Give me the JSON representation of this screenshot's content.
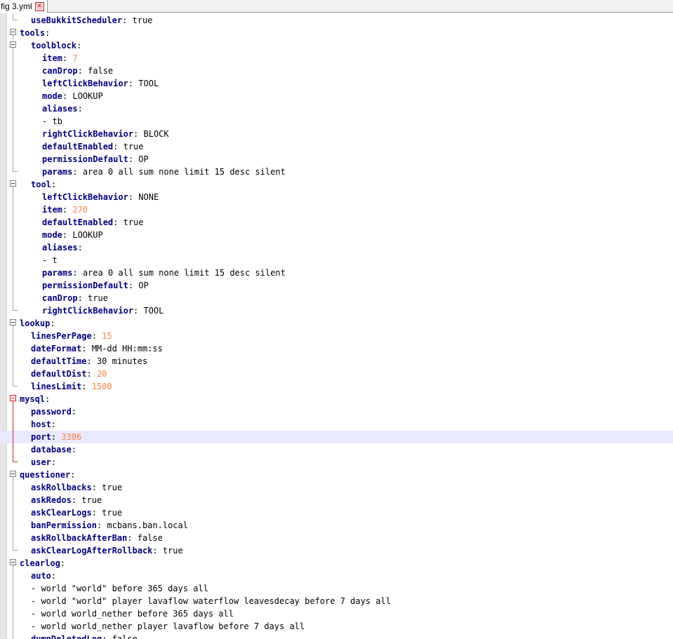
{
  "tab": {
    "label": "fig 3.yml",
    "close_glyph": "✕"
  },
  "accent_colors": {
    "key": "#000080",
    "number": "#ff8040",
    "current_line": "#e8e8ff",
    "fold_active": "#dd2222"
  },
  "lines": [
    {
      "indent": 2,
      "key": "useBukkitScheduler",
      "sep": ": ",
      "value": "true",
      "vtype": "text",
      "fold": "end"
    },
    {
      "indent": 0,
      "key": "tools",
      "sep": ":",
      "value": "",
      "vtype": "text",
      "fold": "open"
    },
    {
      "indent": 2,
      "key": "toolblock",
      "sep": ":",
      "value": "",
      "vtype": "text",
      "fold": "open"
    },
    {
      "indent": 4,
      "key": "item",
      "sep": ": ",
      "value": "7",
      "vtype": "number",
      "fold": "line"
    },
    {
      "indent": 4,
      "key": "canDrop",
      "sep": ": ",
      "value": "false",
      "vtype": "text",
      "fold": "line"
    },
    {
      "indent": 4,
      "key": "leftClickBehavior",
      "sep": ": ",
      "value": "TOOL",
      "vtype": "text",
      "fold": "line"
    },
    {
      "indent": 4,
      "key": "mode",
      "sep": ": ",
      "value": "LOOKUP",
      "vtype": "text",
      "fold": "line"
    },
    {
      "indent": 4,
      "key": "aliases",
      "sep": ":",
      "value": "",
      "vtype": "text",
      "fold": "line"
    },
    {
      "indent": 4,
      "key": "",
      "sep": "",
      "value": "- tb",
      "vtype": "text",
      "fold": "line"
    },
    {
      "indent": 4,
      "key": "rightClickBehavior",
      "sep": ": ",
      "value": "BLOCK",
      "vtype": "text",
      "fold": "line"
    },
    {
      "indent": 4,
      "key": "defaultEnabled",
      "sep": ": ",
      "value": "true",
      "vtype": "text",
      "fold": "line"
    },
    {
      "indent": 4,
      "key": "permissionDefault",
      "sep": ": ",
      "value": "OP",
      "vtype": "text",
      "fold": "line"
    },
    {
      "indent": 4,
      "key": "params",
      "sep": ": ",
      "value": "area 0 all sum none limit 15 desc silent",
      "vtype": "text",
      "fold": "end"
    },
    {
      "indent": 2,
      "key": "tool",
      "sep": ":",
      "value": "",
      "vtype": "text",
      "fold": "open"
    },
    {
      "indent": 4,
      "key": "leftClickBehavior",
      "sep": ": ",
      "value": "NONE",
      "vtype": "text",
      "fold": "line"
    },
    {
      "indent": 4,
      "key": "item",
      "sep": ": ",
      "value": "270",
      "vtype": "number",
      "fold": "line"
    },
    {
      "indent": 4,
      "key": "defaultEnabled",
      "sep": ": ",
      "value": "true",
      "vtype": "text",
      "fold": "line"
    },
    {
      "indent": 4,
      "key": "mode",
      "sep": ": ",
      "value": "LOOKUP",
      "vtype": "text",
      "fold": "line"
    },
    {
      "indent": 4,
      "key": "aliases",
      "sep": ":",
      "value": "",
      "vtype": "text",
      "fold": "line"
    },
    {
      "indent": 4,
      "key": "",
      "sep": "",
      "value": "- t",
      "vtype": "text",
      "fold": "line"
    },
    {
      "indent": 4,
      "key": "params",
      "sep": ": ",
      "value": "area 0 all sum none limit 15 desc silent",
      "vtype": "text",
      "fold": "line"
    },
    {
      "indent": 4,
      "key": "permissionDefault",
      "sep": ": ",
      "value": "OP",
      "vtype": "text",
      "fold": "line"
    },
    {
      "indent": 4,
      "key": "canDrop",
      "sep": ": ",
      "value": "true",
      "vtype": "text",
      "fold": "line"
    },
    {
      "indent": 4,
      "key": "rightClickBehavior",
      "sep": ": ",
      "value": "TOOL",
      "vtype": "text",
      "fold": "end"
    },
    {
      "indent": 0,
      "key": "lookup",
      "sep": ":",
      "value": "",
      "vtype": "text",
      "fold": "open"
    },
    {
      "indent": 2,
      "key": "linesPerPage",
      "sep": ": ",
      "value": "15",
      "vtype": "number",
      "fold": "line"
    },
    {
      "indent": 2,
      "key": "dateFormat",
      "sep": ": ",
      "value": "MM-dd HH:mm:ss",
      "vtype": "text",
      "fold": "line"
    },
    {
      "indent": 2,
      "key": "defaultTime",
      "sep": ": ",
      "value": "30 minutes",
      "vtype": "text",
      "fold": "line"
    },
    {
      "indent": 2,
      "key": "defaultDist",
      "sep": ": ",
      "value": "20",
      "vtype": "number",
      "fold": "line"
    },
    {
      "indent": 2,
      "key": "linesLimit",
      "sep": ": ",
      "value": "1500",
      "vtype": "number",
      "fold": "end"
    },
    {
      "indent": 0,
      "key": "mysql",
      "sep": ":",
      "value": "",
      "vtype": "text",
      "fold": "open-red"
    },
    {
      "indent": 2,
      "key": "password",
      "sep": ":",
      "value": "",
      "vtype": "text",
      "fold": "line-red"
    },
    {
      "indent": 2,
      "key": "host",
      "sep": ":",
      "value": "",
      "vtype": "text",
      "fold": "line-red"
    },
    {
      "indent": 2,
      "key": "port",
      "sep": ": ",
      "value": "3306",
      "vtype": "number",
      "fold": "line-red",
      "current": true
    },
    {
      "indent": 2,
      "key": "database",
      "sep": ":",
      "value": "",
      "vtype": "text",
      "fold": "line-red"
    },
    {
      "indent": 2,
      "key": "user",
      "sep": ":",
      "value": "",
      "vtype": "text",
      "fold": "end-red"
    },
    {
      "indent": 0,
      "key": "questioner",
      "sep": ":",
      "value": "",
      "vtype": "text",
      "fold": "open"
    },
    {
      "indent": 2,
      "key": "askRollbacks",
      "sep": ": ",
      "value": "true",
      "vtype": "text",
      "fold": "line"
    },
    {
      "indent": 2,
      "key": "askRedos",
      "sep": ": ",
      "value": "true",
      "vtype": "text",
      "fold": "line"
    },
    {
      "indent": 2,
      "key": "askClearLogs",
      "sep": ": ",
      "value": "true",
      "vtype": "text",
      "fold": "line"
    },
    {
      "indent": 2,
      "key": "banPermission",
      "sep": ": ",
      "value": "mcbans.ban.local",
      "vtype": "text",
      "fold": "line"
    },
    {
      "indent": 2,
      "key": "askRollbackAfterBan",
      "sep": ": ",
      "value": "false",
      "vtype": "text",
      "fold": "line"
    },
    {
      "indent": 2,
      "key": "askClearLogAfterRollback",
      "sep": ": ",
      "value": "true",
      "vtype": "text",
      "fold": "end"
    },
    {
      "indent": 0,
      "key": "clearlog",
      "sep": ":",
      "value": "",
      "vtype": "text",
      "fold": "open"
    },
    {
      "indent": 2,
      "key": "auto",
      "sep": ":",
      "value": "",
      "vtype": "text",
      "fold": "line"
    },
    {
      "indent": 2,
      "key": "",
      "sep": "",
      "value": "- world \"world\" before 365 days all",
      "vtype": "text",
      "fold": "line"
    },
    {
      "indent": 2,
      "key": "",
      "sep": "",
      "value": "- world \"world\" player lavaflow waterflow leavesdecay before 7 days all",
      "vtype": "text",
      "fold": "line"
    },
    {
      "indent": 2,
      "key": "",
      "sep": "",
      "value": "- world world_nether before 365 days all",
      "vtype": "text",
      "fold": "line"
    },
    {
      "indent": 2,
      "key": "",
      "sep": "",
      "value": "- world world_nether player lavaflow before 7 days all",
      "vtype": "text",
      "fold": "line"
    },
    {
      "indent": 2,
      "key": "dumpDeletedLog",
      "sep": ": ",
      "value": "false",
      "vtype": "text",
      "fold": "line"
    }
  ]
}
